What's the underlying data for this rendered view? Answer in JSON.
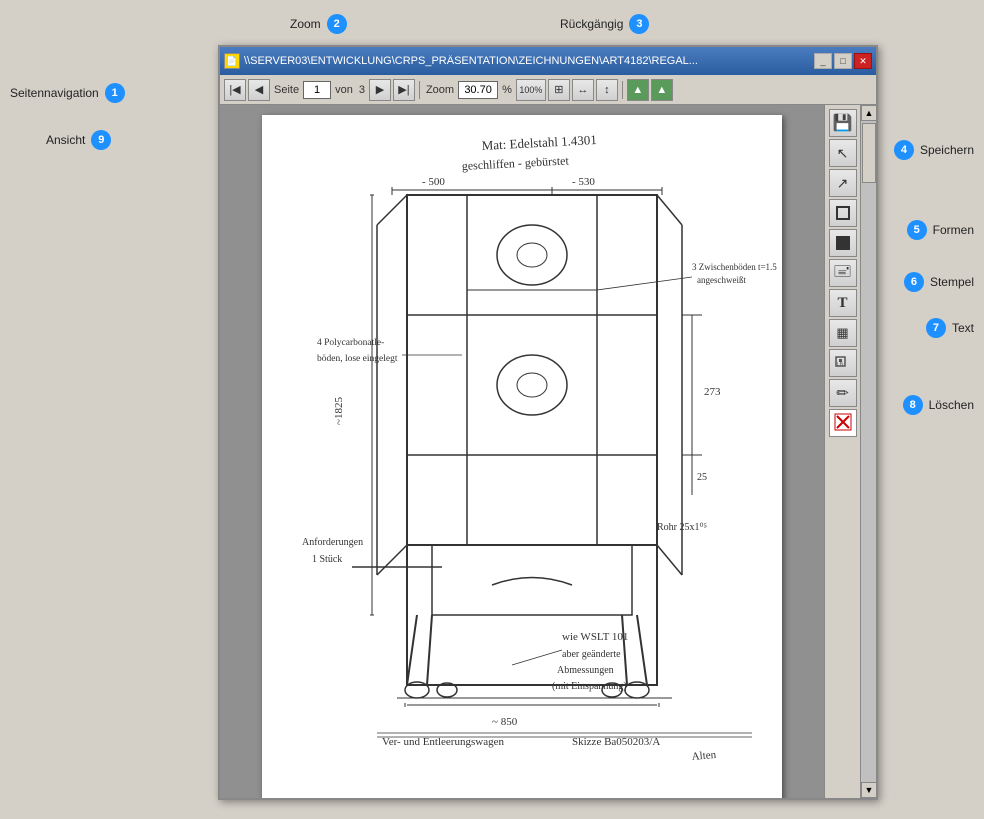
{
  "callouts": {
    "zoom_label": "Zoom",
    "zoom_badge": "2",
    "rueckgaengig_label": "Rückgängig",
    "rueckgaengig_badge": "3",
    "seitennavigation_label": "Seitennavigation",
    "seitennavigation_badge": "1",
    "ansicht_label": "Ansicht",
    "ansicht_badge": "9",
    "speichern_label": "Speichern",
    "speichern_badge": "4",
    "formen_label": "Formen",
    "formen_badge": "5",
    "stempel_label": "Stempel",
    "stempel_badge": "6",
    "text_label": "Text",
    "text_badge": "7",
    "loeschen_label": "Löschen",
    "loeschen_badge": "8"
  },
  "window": {
    "title": "\\\\SERVER03\\ENTWICKLUNG\\CRPS_PRÄSENTATION\\ZEICHNUNGEN\\ART4182\\REGAL...",
    "title_icon": "📄"
  },
  "toolbar": {
    "page_label": "Seite",
    "page_value": "1",
    "von_label": "von",
    "total_pages": "3",
    "zoom_label": "Zoom",
    "zoom_value": "30.70",
    "zoom_percent": "%",
    "zoom_100": "100%"
  },
  "right_toolbar": {
    "btn_save_icon": "💾",
    "btn_cursor_icon": "↖",
    "btn_cursor2_icon": "↗",
    "btn_rect_icon": "□",
    "btn_rect2_icon": "■",
    "btn_stamp_icon": "🖃",
    "btn_text_icon": "T",
    "btn_table_icon": "▦",
    "btn_tag_icon": "🏷",
    "btn_pen_icon": "✏",
    "btn_delete_icon": "✖"
  },
  "accent_color": "#1e90ff",
  "badge_bg": "#1e90ff"
}
